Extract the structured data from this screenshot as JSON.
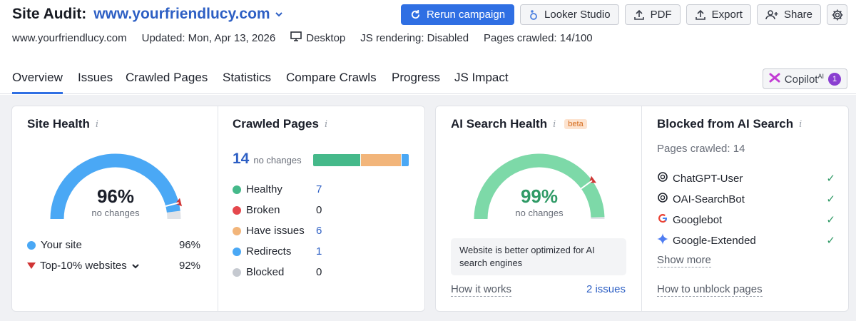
{
  "header": {
    "title_label": "Site Audit:",
    "domain": "www.yourfriendlucy.com",
    "buttons": {
      "rerun": "Rerun campaign",
      "looker": "Looker Studio",
      "pdf": "PDF",
      "export": "Export",
      "share": "Share"
    }
  },
  "meta": {
    "site": "www.yourfriendlucy.com",
    "updated": "Updated: Mon, Apr 13, 2026",
    "device": "Desktop",
    "js_rendering": "JS rendering: Disabled",
    "pages_crawled": "Pages crawled: 14/100"
  },
  "tabs": [
    "Overview",
    "Issues",
    "Crawled Pages",
    "Statistics",
    "Compare Crawls",
    "Progress",
    "JS Impact"
  ],
  "copilot": {
    "label": "Copilot",
    "sup": "AI",
    "count": "1"
  },
  "site_health": {
    "title": "Site Health",
    "percent_text": "96%",
    "sub": "no changes",
    "value": 0.96,
    "top10_value": 0.92,
    "legend": [
      {
        "label": "Your site",
        "value": "96%",
        "color": "#4aa8f5"
      },
      {
        "label": "Top-10% websites",
        "value": "92%",
        "color": "#d03434"
      }
    ]
  },
  "crawled_pages": {
    "title": "Crawled Pages",
    "total": "14",
    "sub": "no changes",
    "bar": [
      {
        "value": 7,
        "color": "#45b98a"
      },
      {
        "value": 6,
        "color": "#f2b57a"
      },
      {
        "value": 1,
        "color": "#4aa8f5"
      }
    ],
    "rows": [
      {
        "label": "Healthy",
        "value": "7",
        "color": "#45b98a",
        "link": true
      },
      {
        "label": "Broken",
        "value": "0",
        "color": "#e5484d",
        "link": false
      },
      {
        "label": "Have issues",
        "value": "6",
        "color": "#f2b57a",
        "link": true
      },
      {
        "label": "Redirects",
        "value": "1",
        "color": "#4aa8f5",
        "link": true
      },
      {
        "label": "Blocked",
        "value": "0",
        "color": "#c5c9d0",
        "link": false
      }
    ]
  },
  "ai_health": {
    "title": "AI Search Health",
    "beta": "beta",
    "percent_text": "99%",
    "sub": "no changes",
    "value": 0.99,
    "notice": "Website is better optimized for AI search engines",
    "how_it_works": "How it works",
    "issues": "2 issues",
    "color": "#7dd9a8"
  },
  "blocked": {
    "title": "Blocked from AI Search",
    "pages_crawled": "Pages crawled: 14",
    "bots": [
      {
        "label": "ChatGPT-User",
        "icon": "openai-icon"
      },
      {
        "label": "OAI-SearchBot",
        "icon": "openai-icon"
      },
      {
        "label": "Googlebot",
        "icon": "google-icon"
      },
      {
        "label": "Google-Extended",
        "icon": "gemini-icon"
      }
    ],
    "show_more": "Show more",
    "unblock": "How to unblock pages"
  }
}
